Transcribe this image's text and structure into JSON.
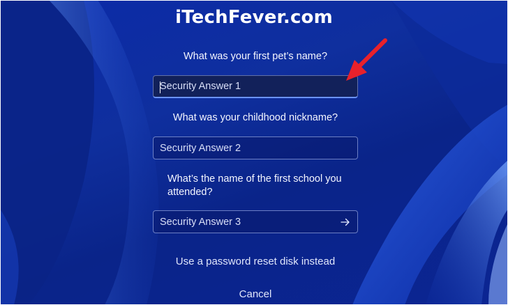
{
  "watermark": "iTechFever.com",
  "questions": [
    {
      "label": "What was your first pet’s name?",
      "placeholder": "Security Answer 1",
      "value": ""
    },
    {
      "label": "What was your childhood nickname?",
      "placeholder": "Security Answer 2",
      "value": ""
    },
    {
      "label": "What’s the name of the first school you attended?",
      "placeholder": "Security Answer 3",
      "value": ""
    }
  ],
  "links": {
    "reset_disk": "Use a password reset disk instead",
    "cancel": "Cancel"
  },
  "icons": {
    "submit": "arrow-right-icon",
    "annotation": "red-arrow-icon"
  },
  "colors": {
    "background": "#0b2aa8",
    "annotation": "#e8212b",
    "focus_underline": "#6b93ff"
  }
}
